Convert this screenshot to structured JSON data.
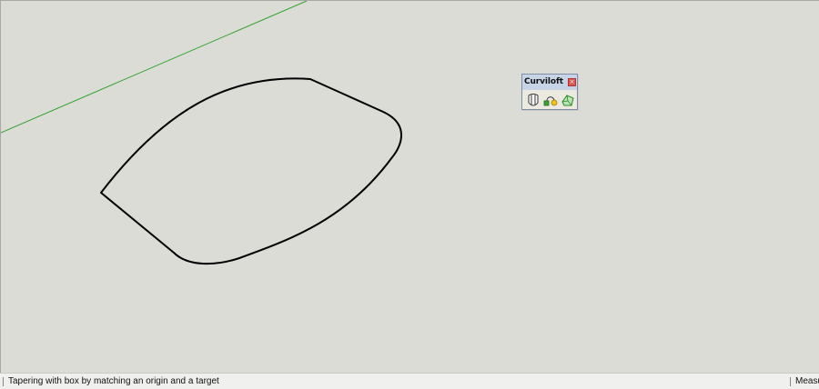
{
  "viewport": {
    "background": "#dcdcd6",
    "axis_color": "#2fa32f",
    "curve_color": "#000000"
  },
  "toolbar": {
    "title": "Curviloft",
    "close_icon": "close-x-icon",
    "tools": [
      {
        "name": "loft-by-spline-icon"
      },
      {
        "name": "loft-along-path-icon"
      },
      {
        "name": "skinning-contours-icon"
      }
    ]
  },
  "statusbar": {
    "message": "Tapering with box by matching an origin and a target",
    "measurements_label": "Measurements"
  }
}
